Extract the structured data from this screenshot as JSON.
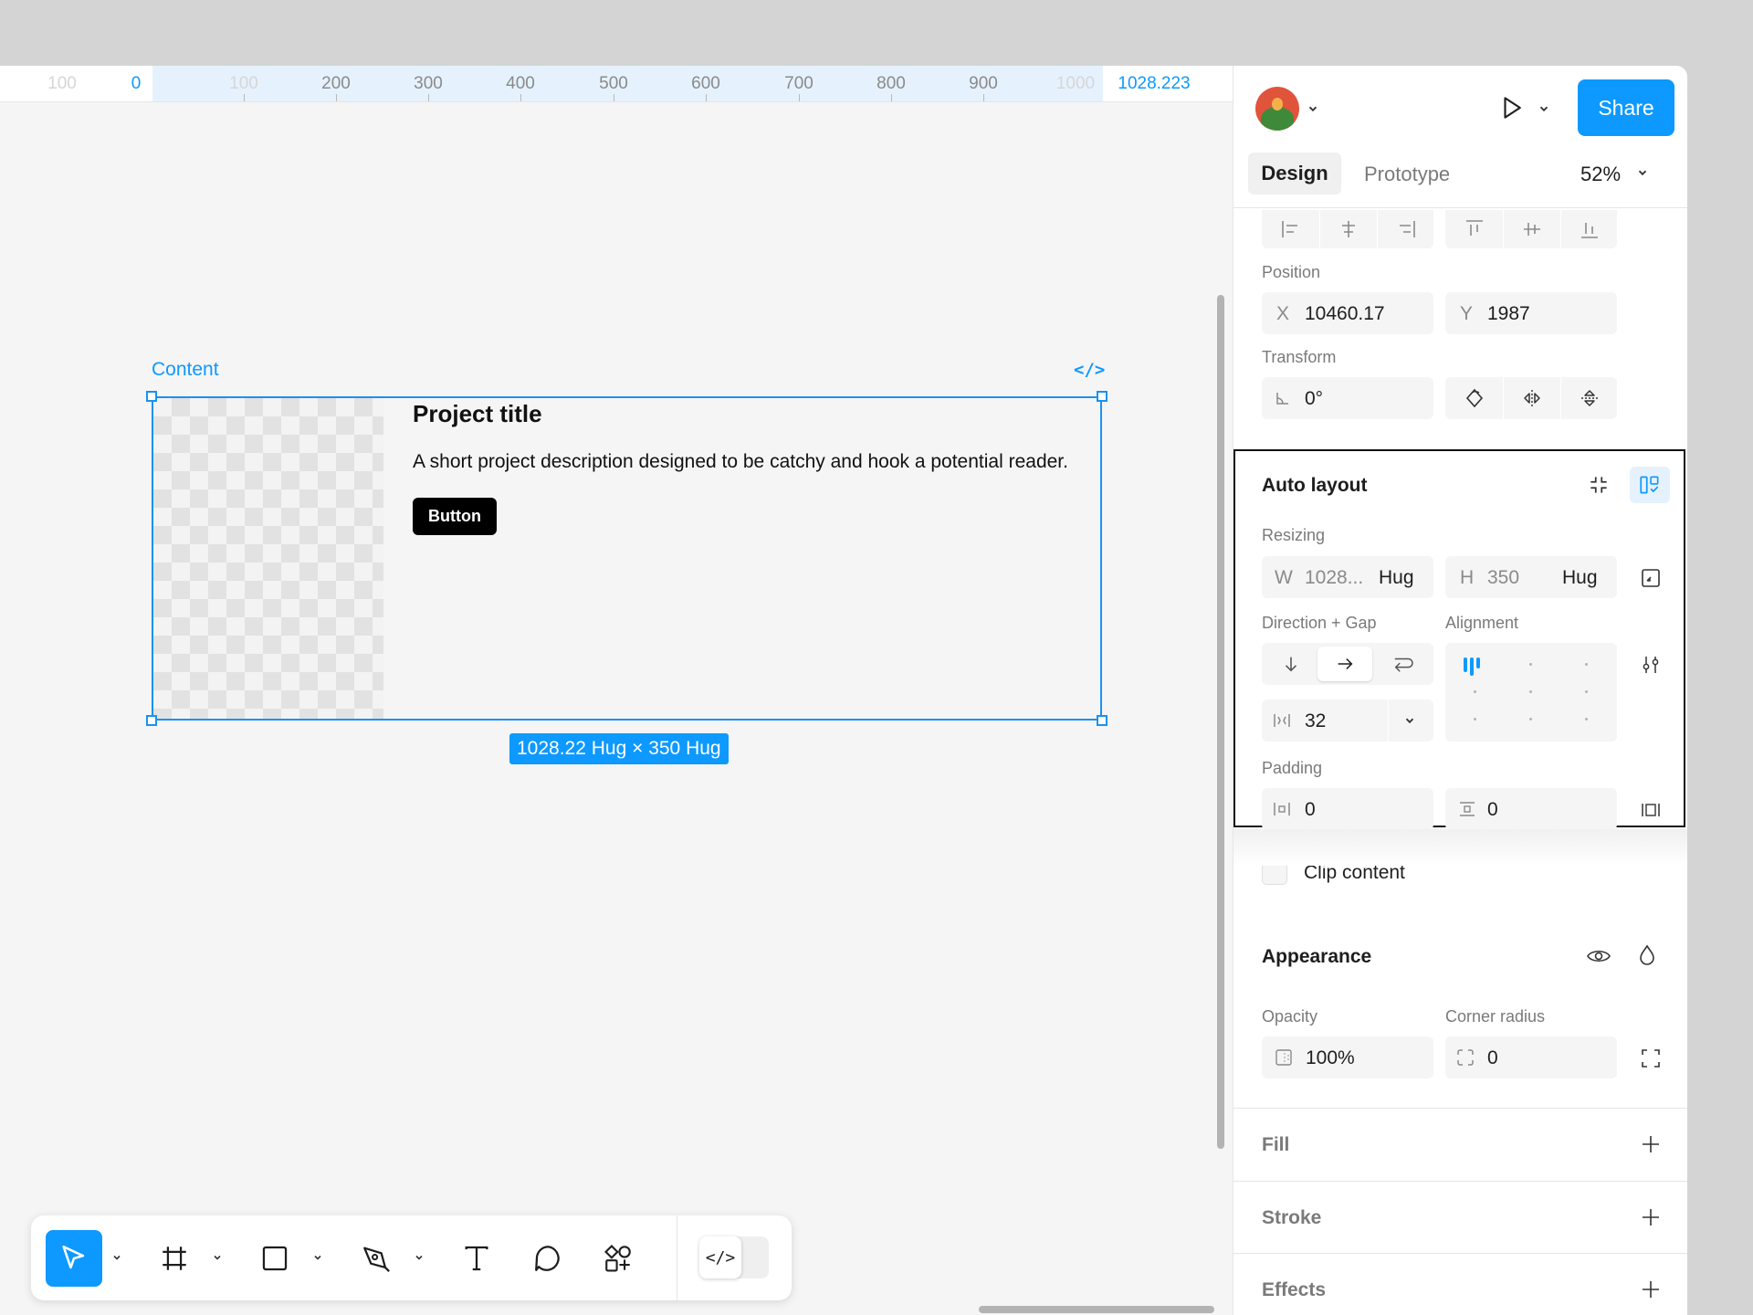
{
  "ruler": {
    "labels": [
      "100",
      "0",
      "100",
      "200",
      "300",
      "400",
      "500",
      "600",
      "700",
      "800",
      "900",
      "1000",
      "1028.223"
    ]
  },
  "canvas": {
    "frame_label": "Content",
    "code_mark": "</>",
    "project_title": "Project title",
    "project_description": "A short project description designed to be catchy and hook a potential reader.",
    "button_label": "Button",
    "dimensions_badge": "1028.22 Hug × 350 Hug"
  },
  "toolbar": {
    "tools": [
      "move-tool",
      "frame-tool",
      "rectangle-tool",
      "pen-tool",
      "text-tool",
      "comment-tool",
      "actions-tool"
    ],
    "active_tool": "move-tool",
    "devmode_label": "</>"
  },
  "header": {
    "share_label": "Share",
    "tabs": [
      "Design",
      "Prototype"
    ],
    "active_tab": "Design",
    "zoom": "52%"
  },
  "position": {
    "label": "Position",
    "x_prefix": "X",
    "x_value": "10460.17",
    "y_prefix": "Y",
    "y_value": "1987"
  },
  "transform": {
    "label": "Transform",
    "rotation": "0°"
  },
  "auto_layout": {
    "title": "Auto layout",
    "resizing_label": "Resizing",
    "w_prefix": "W",
    "w_value": "1028...",
    "w_mode": "Hug",
    "h_prefix": "H",
    "h_value": "350",
    "h_mode": "Hug",
    "direction_label": "Direction + Gap",
    "alignment_label": "Alignment",
    "gap_value": "32",
    "padding_label": "Padding",
    "padding_horizontal": "0",
    "padding_vertical": "0",
    "clip_content_label": "Clip content",
    "clip_content_checked": false
  },
  "appearance": {
    "title": "Appearance",
    "opacity_label": "Opacity",
    "opacity_value": "100%",
    "corner_radius_label": "Corner radius",
    "corner_radius_value": "0"
  },
  "sections": {
    "fill": "Fill",
    "stroke": "Stroke",
    "effects": "Effects"
  },
  "colors": {
    "accent": "#0d99ff",
    "selection": "#1a92f0",
    "canvas": "#f5f5f5",
    "panel": "#ffffff"
  }
}
